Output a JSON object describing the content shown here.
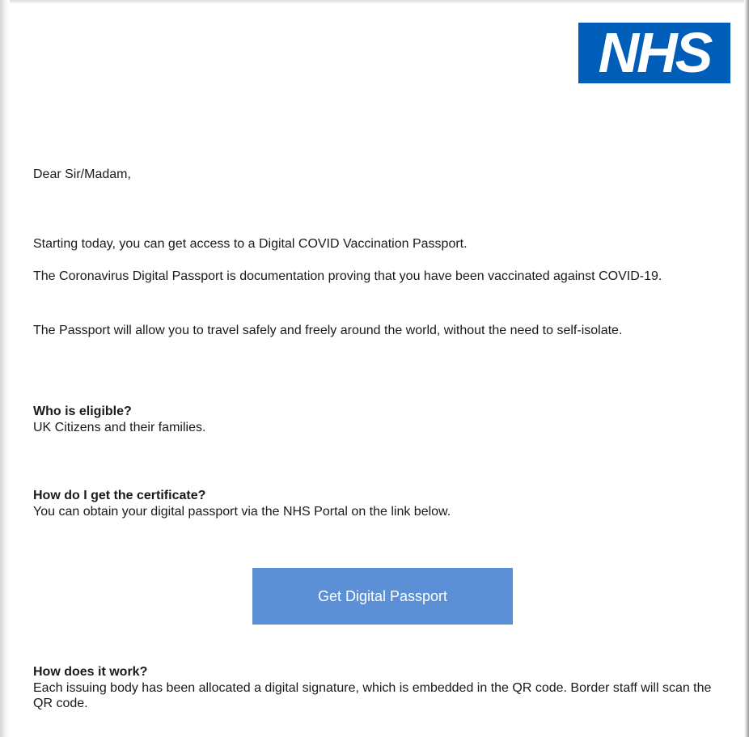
{
  "logo": {
    "text": "NHS",
    "color": "#005eb8"
  },
  "greeting": "Dear Sir/Madam,",
  "paragraphs": [
    "Starting today, you can get access to a Digital COVID Vaccination Passport.",
    "The Coronavirus Digital Passport is documentation proving that you have been vaccinated against COVID-19.",
    "The Passport will allow you to travel safely and freely around the world, without the need to self-isolate."
  ],
  "sections": [
    {
      "heading": "Who is eligible?",
      "body": "UK Citizens and their families."
    },
    {
      "heading": "How do I get the certificate?",
      "body": "You can obtain your digital passport via the NHS Portal on the link below."
    },
    {
      "heading": "How does it work?",
      "body": "Each issuing body has been allocated a digital signature, which is embedded in the QR code. Border staff will scan the QR code."
    }
  ],
  "cta": {
    "label": "Get Digital Passport",
    "color": "#5b8fd6"
  }
}
